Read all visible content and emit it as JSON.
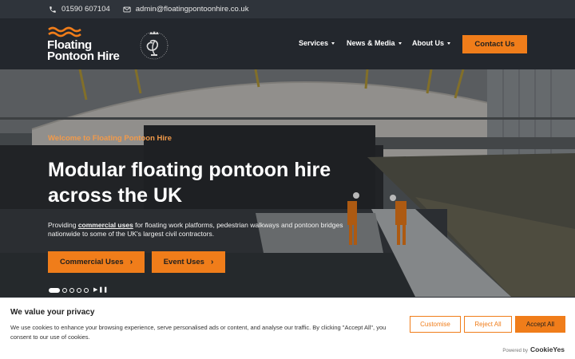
{
  "topbar": {
    "phone": "01590 607104",
    "email": "admin@floatingpontoonhire.co.uk",
    "phone_icon": "phone-icon",
    "email_icon": "envelope-icon"
  },
  "header": {
    "logo_line1": "Floating",
    "logo_line2": "Pontoon Hire",
    "nav": [
      {
        "label": "Services"
      },
      {
        "label": "News & Media"
      },
      {
        "label": "About Us"
      }
    ],
    "contact_label": "Contact Us"
  },
  "hero": {
    "welcome": "Welcome to Floating Pontoon Hire",
    "headline": "Modular floating pontoon hire across the UK",
    "sub_before": "Providing ",
    "sub_link": "commercial uses",
    "sub_after": " for floating work platforms, pedestrian walkways and pontoon bridges nationwide to some of the UK's largest civil contractors.",
    "btn_commercial": "Commercial Uses",
    "btn_event": "Event Uses",
    "arrow_icon": "chevron-right-icon",
    "slide_count": 5,
    "active_slide": 1
  },
  "cookie": {
    "title": "We value your privacy",
    "text": "We use cookies to enhance your browsing experience, serve personalised ads or content, and analyse our traffic. By clicking \"Accept All\", you consent to our use of cookies.",
    "customise": "Customise",
    "reject": "Reject All",
    "accept": "Accept All",
    "powered_by": "Powered by",
    "brand": "CookieYes"
  },
  "colors": {
    "accent": "#f07d1a",
    "header_bg": "#23272d",
    "topbar_bg": "#2f343b"
  }
}
